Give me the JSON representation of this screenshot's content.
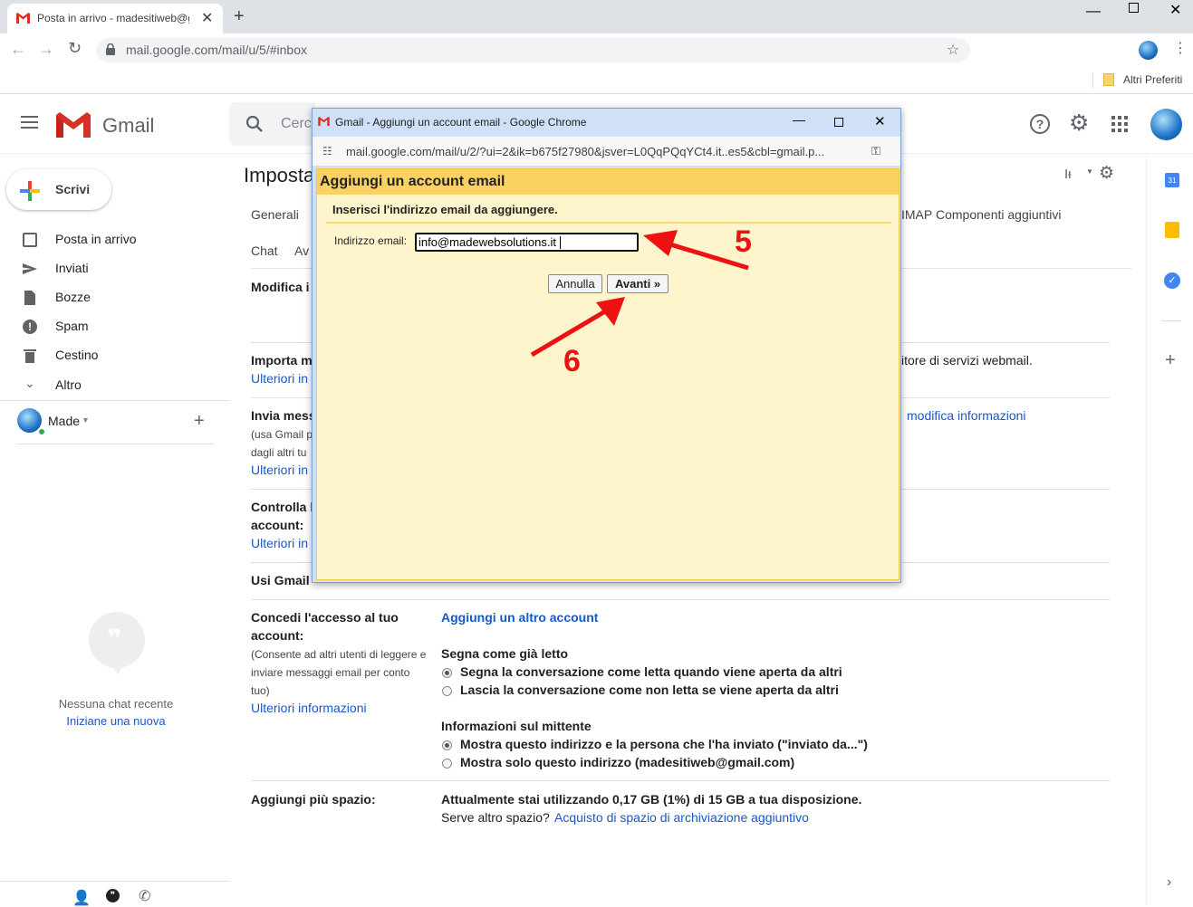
{
  "browser": {
    "tab_title": "Posta in arrivo - madesitiweb@g",
    "url": "mail.google.com/mail/u/5/#inbox",
    "bookmark_folder": "Altri Preferiti"
  },
  "gmail": {
    "logo_text": "Gmail",
    "search_placeholder": "Cerc",
    "compose_label": "Scrivi",
    "nav": [
      {
        "label": "Posta in arrivo"
      },
      {
        "label": "Inviati"
      },
      {
        "label": "Bozze"
      },
      {
        "label": "Spam"
      },
      {
        "label": "Cestino"
      },
      {
        "label": "Altro"
      }
    ],
    "account_label": "Made",
    "chat_empty": "Nessuna chat recente",
    "chat_start": "Iniziane una nuova",
    "settings_title": "Imposta",
    "tabs_row1": [
      "Generali"
    ],
    "tab_imap": "IMAP",
    "tab_addons": "Componenti aggiuntivi",
    "tabs_row2": [
      "Chat",
      "Av"
    ],
    "rows": {
      "modifica": "Modifica i",
      "importa": "Importa m",
      "importa_link": "Ulteriori in",
      "importa_right": "itore di servizi webmail.",
      "invia": "Invia mess",
      "invia_sub1": "(usa Gmail p",
      "invia_sub2": "dagli altri tu",
      "invia_link": "Ulteriori in",
      "invia_right_link": "modifica informazioni",
      "controlla1": "Controlla l",
      "controlla2": "account:",
      "controlla_link": "Ulteriori in",
      "usi": "Usi Gmail",
      "concedi1": "Concedi l'accesso al tuo",
      "concedi2": "account:",
      "concedi_sub1": "(Consente ad altri utenti di leggere e",
      "concedi_sub2": "inviare messaggi email per conto",
      "concedi_sub3": "tuo)",
      "concedi_link": "Ulteriori informazioni",
      "add_account_link": "Aggiungi un altro account",
      "segna_title": "Segna come già letto",
      "segna_opt1": "Segna la conversazione come letta quando viene aperta da altri",
      "segna_opt2": "Lascia la conversazione come non letta se viene aperta da altri",
      "info_title": "Informazioni sul mittente",
      "info_opt1": "Mostra questo indirizzo e la persona che l'ha inviato (\"inviato da...\")",
      "info_opt2": "Mostra solo questo indirizzo (madesitiweb@gmail.com)",
      "spazio_label": "Aggiungi più spazio:",
      "spazio_text": "Attualmente stai utilizzando 0,17 GB (1%) di 15 GB a tua disposizione.",
      "spazio_more": "Serve altro spazio?",
      "spazio_link": "Acquisto di spazio di archiviazione aggiuntivo"
    }
  },
  "popup": {
    "window_title": "Gmail - Aggiungi un account email - Google Chrome",
    "url": "mail.google.com/mail/u/2/?ui=2&ik=b675f27980&jsver=L0QqPQqYCt4.it..es5&cbl=gmail.p...",
    "heading": "Aggiungi un account email",
    "instruction": "Inserisci l'indirizzo email da aggiungere.",
    "field_label": "Indirizzo email:",
    "field_value": "info@madewebsolutions.it",
    "cancel_label": "Annulla",
    "next_label": "Avanti »"
  },
  "annotations": {
    "step5": "5",
    "step6": "6",
    "arrow_color": "#ee1111"
  }
}
